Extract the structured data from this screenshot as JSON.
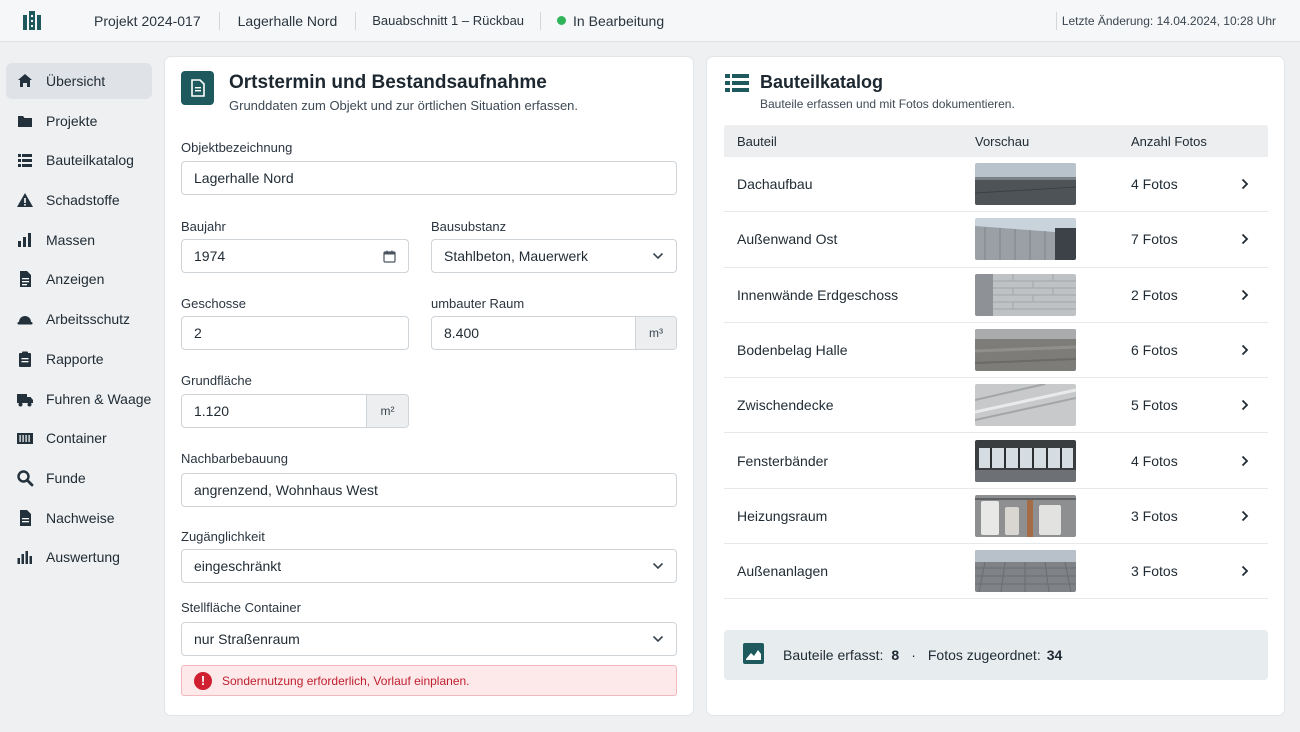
{
  "topbar": {
    "project": "Projekt 2024-017",
    "site": "Lagerhalle Nord",
    "phase": "Bauabschnitt 1 – Rückbau",
    "status": "In Bearbeitung",
    "status_color": "#2fb45a",
    "last_change": "Letzte Änderung: 14.04.2024, 10:28 Uhr"
  },
  "sidebar": {
    "items": [
      {
        "label": "Übersicht",
        "icon": "home-icon"
      },
      {
        "label": "Projekte",
        "icon": "folder-icon"
      },
      {
        "label": "Bauteilkatalog",
        "icon": "list-icon"
      },
      {
        "label": "Schadstoffe",
        "icon": "warning-icon"
      },
      {
        "label": "Massen",
        "icon": "bar-chart-icon"
      },
      {
        "label": "Anzeigen",
        "icon": "document-icon"
      },
      {
        "label": "Arbeitsschutz",
        "icon": "helmet-icon"
      },
      {
        "label": "Rapporte",
        "icon": "clipboard-icon"
      },
      {
        "label": "Fuhren & Waage",
        "icon": "truck-icon"
      },
      {
        "label": "Container",
        "icon": "container-icon"
      },
      {
        "label": "Funde",
        "icon": "search-icon"
      },
      {
        "label": "Nachweise",
        "icon": "file-icon"
      },
      {
        "label": "Auswertung",
        "icon": "stats-icon"
      }
    ]
  },
  "form": {
    "title": "Ortstermin und Bestandsaufnahme",
    "subtitle": "Grunddaten zum Objekt und zur örtlichen Situation erfassen.",
    "object_label": "Objektbezeichnung",
    "object_value": "Lagerhalle Nord",
    "year_label": "Baujahr",
    "year_value": "1974",
    "substance_label": "Bausubstanz",
    "substance_value": "Stahlbeton, Mauerwerk",
    "floors_label": "Geschosse",
    "floors_value": "2",
    "volume_label": "umbauter Raum",
    "volume_value": "8.400",
    "volume_unit": "m³",
    "area_label": "Grundfläche",
    "area_value": "1.120",
    "area_unit": "m²",
    "neighbors_label": "Nachbarbebauung",
    "neighbors_value": "angrenzend, Wohnhaus West",
    "access_label": "Zugänglichkeit",
    "access_value": "eingeschränkt",
    "container_label": "Stellfläche Container",
    "container_value": "nur Straßenraum",
    "alert_text": "Sondernutzung erforderlich, Vorlauf einplanen."
  },
  "catalog": {
    "title": "Bauteilkatalog",
    "subtitle": "Bauteile erfassen und mit Fotos dokumentieren.",
    "headers": [
      "Bauteil",
      "Vorschau",
      "Anzahl Fotos"
    ],
    "rows": [
      {
        "name": "Dachaufbau",
        "photos": "4 Fotos",
        "thumb": "roof"
      },
      {
        "name": "Außenwand Ost",
        "photos": "7 Fotos",
        "thumb": "wall"
      },
      {
        "name": "Innenwände Erdgeschoss",
        "photos": "2 Fotos",
        "thumb": "blocks"
      },
      {
        "name": "Bodenbelag Halle",
        "photos": "6 Fotos",
        "thumb": "floor"
      },
      {
        "name": "Zwischendecke",
        "photos": "5 Fotos",
        "thumb": "ceiling"
      },
      {
        "name": "Fensterbänder",
        "photos": "4 Fotos",
        "thumb": "windows"
      },
      {
        "name": "Heizungsraum",
        "photos": "3 Fotos",
        "thumb": "boiler"
      },
      {
        "name": "Außenanlagen",
        "photos": "3 Fotos",
        "thumb": "yard"
      }
    ],
    "summary_components_label": "Bauteile erfasst:",
    "summary_components_value": "8",
    "summary_dot": "·",
    "summary_photos_label": "Fotos zugeordnet:",
    "summary_photos_value": "34"
  },
  "colors": {
    "accent": "#1e5a5d",
    "alert": "#d01f30"
  }
}
